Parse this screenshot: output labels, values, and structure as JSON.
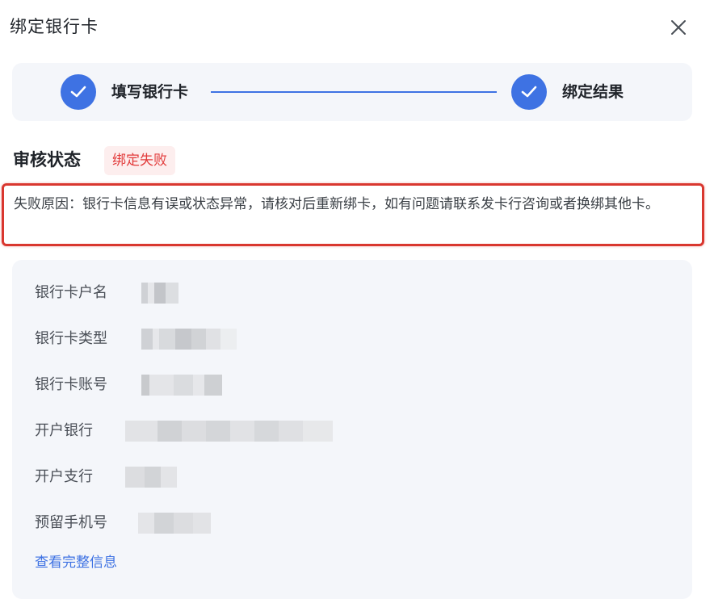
{
  "dialog": {
    "title": "绑定银行卡",
    "close_icon": "close-icon"
  },
  "stepper": {
    "steps": [
      {
        "label": "填写银行卡",
        "icon": "check-icon",
        "status": "done"
      },
      {
        "label": "绑定结果",
        "icon": "check-icon",
        "status": "done"
      }
    ],
    "accent_color": "#3e72e3"
  },
  "review": {
    "label": "审核状态",
    "status": "绑定失败",
    "status_color": "#e23b3b"
  },
  "failure": {
    "reason": "失败原因：银行卡信息有误或状态异常，请核对后重新绑卡，如有问题请联系发卡行咨询或者换绑其他卡。",
    "highlight_color": "#d9372f"
  },
  "info": {
    "fields": [
      {
        "label": "银行卡户名"
      },
      {
        "label": "银行卡类型"
      },
      {
        "label": "银行卡账号"
      },
      {
        "label": "开户银行"
      },
      {
        "label": "开户支行"
      },
      {
        "label": "预留手机号"
      }
    ],
    "link": "查看完整信息",
    "link_color": "#3e72e3"
  }
}
